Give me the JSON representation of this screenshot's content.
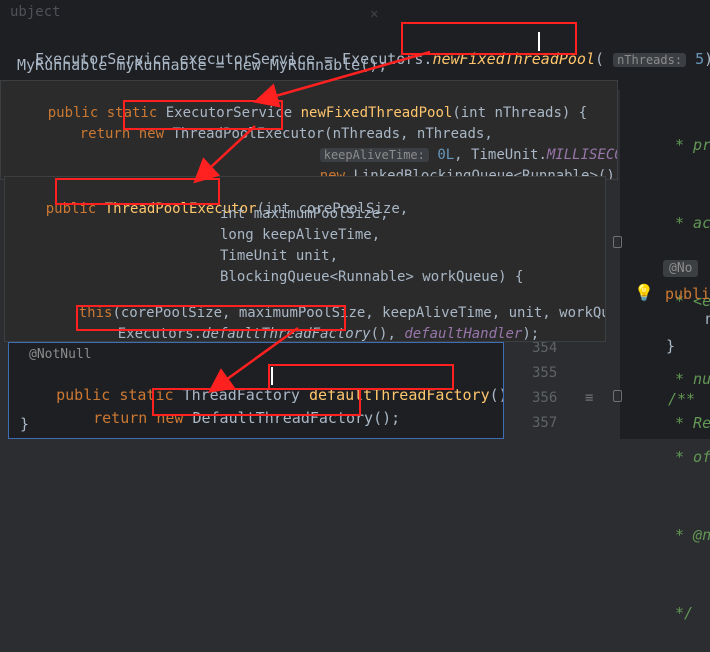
{
  "top_editor": {
    "line1": {
      "type": "ExecutorService",
      "var": "executorService",
      "eq": "=",
      "cls": "Executors",
      "method": "newFixedThreadPool",
      "hint": "nThreads:",
      "arg": "5",
      "tail": ");"
    },
    "line2": "MyRunnable myRunnable = new MyRunnable();",
    "faded_top": "ubject"
  },
  "popup1": {
    "line1_kw": "public static",
    "line1_type": "ExecutorService",
    "line1_method": "newFixedThreadPool",
    "line1_params": "(int nThreads) {",
    "line2_kw": "return new",
    "line2_cls": "ThreadPoolExecutor",
    "line2_args": "(nThreads, nThreads,",
    "line3_hint": "keepAliveTime:",
    "line3_num": "0L",
    "line3_rest": ", TimeUnit.",
    "line3_const": "MILLISECONDS",
    "line3_end": ",",
    "line4_kw": "new",
    "line4_rest": "LinkedBlockingQueue<Runnable>());"
  },
  "popup2": {
    "line1_kw": "public",
    "line1_cls": "ThreadPoolExecutor",
    "line1_params": "(int corePoolSize,",
    "line2": "int maximumPoolSize,",
    "line3": "long keepAliveTime,",
    "line4": "TimeUnit unit,",
    "line5": "BlockingQueue<Runnable> workQueue) {",
    "line6_kw": "this",
    "line6_rest": "(corePoolSize, maximumPoolSize, keepAliveTime, unit, workQueue,",
    "line7_cls": "Executors.",
    "line7_method": "defaultThreadFactory",
    "line7_paren": "(),",
    "line7_field": "defaultHandler",
    "line7_end": ");"
  },
  "popup3": {
    "annotation": "@NotNull",
    "line1_kw": "public static",
    "line1_type": "ThreadFactory",
    "line1_method": "defaultThreadFactory",
    "line1_end": "() {",
    "line2_kw": "return new",
    "line2_cls": "DefaultThreadFactory();",
    "line3": "}"
  },
  "right_panel": {
    "lines": [
      "* pr",
      "* ac",
      "* <e",
      "* nu",
      "* of",
      "* @n",
      "*/"
    ],
    "annotation": "@No",
    "publi": "publi",
    "n_char": "n",
    "brace": "}",
    "comment_open": "/**",
    "comment_re": "* Re"
  },
  "gutter": {
    "numbers": [
      "354",
      "355",
      "356",
      "357"
    ]
  },
  "colors": {
    "background": "#2b2d30",
    "editor_bg": "#1e1f22",
    "popup_bg": "#2b2b2b",
    "highlight_box": "#ff2020",
    "keyword": "#cc7832",
    "method": "#ffc66d"
  }
}
